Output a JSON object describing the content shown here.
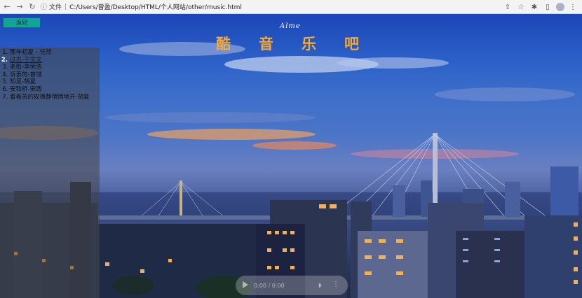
{
  "browser": {
    "file_label": "文件",
    "url": "C:/Users/曾盈/Desktop/HTML/个人网站/other/music.html"
  },
  "page": {
    "back_label": "返回",
    "signature": "Alme",
    "title": "酷音乐吧"
  },
  "playlist": {
    "items": [
      "那年初夏 - 任然",
      "过去-于文文",
      "老街-李荣浩",
      "诉衷的-曾惜",
      "知足-胡夏",
      "安和桥-宋西",
      "看着苦的玫瑰静悄悄地开-胡夏"
    ],
    "active_index": 1
  },
  "player": {
    "time": "0:00 / 0:00"
  },
  "colors": {
    "title": "#f2a93a",
    "back_button": "#13a39a"
  }
}
